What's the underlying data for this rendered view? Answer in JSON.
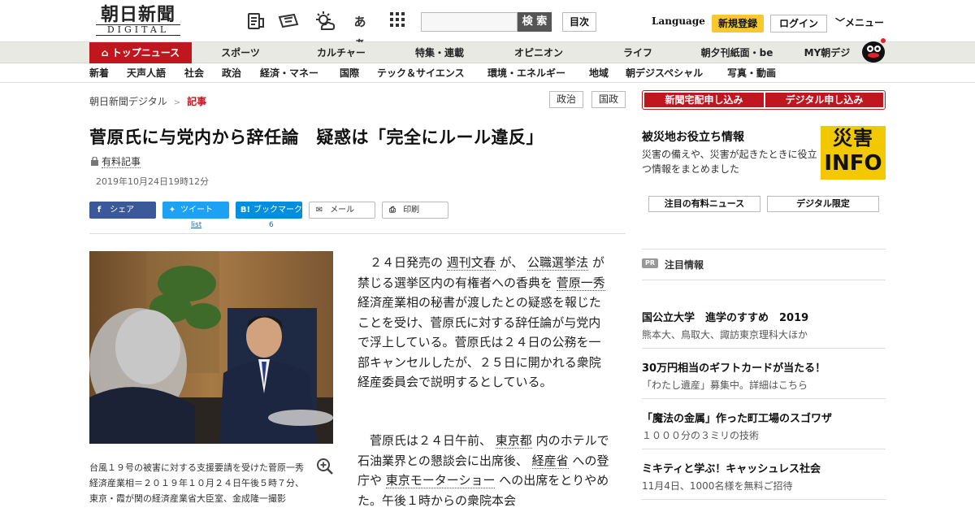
{
  "header": {
    "logo_main": "朝日新聞",
    "logo_sub": "DIGITAL",
    "icons": [
      "newspaper-icon",
      "ticket-icon",
      "weather-icon",
      "font-size-icon",
      "grid-icon"
    ],
    "font_toggle": "あぁ",
    "search_button": "検 索",
    "index_button": "目次",
    "language": "Language",
    "register": "新規登録",
    "login": "ログイン",
    "menu": "メニュー"
  },
  "nav_primary": [
    {
      "label": "トップニュース",
      "active": true
    },
    {
      "label": "スポーツ"
    },
    {
      "label": "カルチャー"
    },
    {
      "label": "特集・連載"
    },
    {
      "label": "オピニオン"
    },
    {
      "label": "ライフ"
    },
    {
      "label": "朝夕刊紙面・be"
    },
    {
      "label": "MY朝デジ"
    }
  ],
  "nav_secondary": [
    "新着",
    "天声人語",
    "社会",
    "政治",
    "経済・マネー",
    "国際",
    "テック＆サイエンス",
    "環境・エネルギー",
    "地域",
    "朝デジスペシャル",
    "写真・動画"
  ],
  "breadcrumb": {
    "home": "朝日新聞デジタル",
    "sep": ">",
    "current": "記事"
  },
  "tags": [
    "政治",
    "国政"
  ],
  "article": {
    "title": "菅原氏に与党内から辞任論　疑惑は「完全にルール違反」",
    "paid_label": "有料記事",
    "date": "2019年10月24日19時12分",
    "share": {
      "facebook": "シェア",
      "twitter": "ツイート",
      "twitter_count": "list",
      "hatena": "ブックマーク",
      "hatena_count": "6",
      "mail": "メール",
      "print": "印刷"
    },
    "caption": "台風１９号の被害に対する支援要請を受けた菅原一秀経済産業相＝２０１９年１０月２４日午後５時７分、東京・霞が関の経済産業省大臣室、金成隆一撮影",
    "para1": [
      {
        "t": "２４日発売の "
      },
      {
        "t": "週刊文春",
        "link": true
      },
      {
        "t": " が、 "
      },
      {
        "t": "公職選挙法",
        "link": true
      },
      {
        "t": " が禁じる選挙区内の有権者への香典を "
      },
      {
        "t": "菅原一秀",
        "link": true
      },
      {
        "t": " 経済産業相の秘書が渡したとの疑惑を報じたことを受け、菅原氏に対する辞任論が与党内で浮上している。菅原氏は２４日の公務を一部キャンセルしたが、２５日に開かれる衆院経産委員会で説明するとしている。"
      }
    ],
    "para2": [
      {
        "t": "菅原氏は２４日午前、 "
      },
      {
        "t": "東京都",
        "link": true
      },
      {
        "t": " 内のホテルで石油業界との懇談会に出席後、 "
      },
      {
        "t": "経産省",
        "link": true
      },
      {
        "t": " への登庁や "
      },
      {
        "t": "東京モーターショー",
        "link": true
      },
      {
        "t": " への出席をとりやめた。午後１時からの衆院本会"
      }
    ]
  },
  "sidebar": {
    "subscribe_paper": "新聞宅配申し込み",
    "subscribe_digital": "デジタル申し込み",
    "disaster_title": "被災地お役立ち情報",
    "disaster_desc": "災害の備えや、災害が起きたときに役立つ情報をまとめました",
    "disaster_logo_1": "災害",
    "disaster_logo_2": "INFO",
    "tab_paid": "注目の有料ニュース",
    "tab_digital": "デジタル限定",
    "pr_badge": "PR",
    "pr_title": "注目情報",
    "pr_items": [
      {
        "headline": "国公立大学　進学のすすめ　2019",
        "sub": "熊本大、鳥取大、諏訪東京理科大ほか"
      },
      {
        "headline": "30万円相当のギフトカードが当たる！",
        "sub": "「わたし遺産」募集中。詳細はこちら"
      },
      {
        "headline": "「魔法の金属」作った町工場のスゴワザ",
        "sub": "１０００分の３ミリの技術"
      },
      {
        "headline": "ミキティと学ぶ！キャッシュレス社会",
        "sub": "11月4日、1000名様を無料ご招待"
      }
    ]
  },
  "colors": {
    "brand_red": "#c0161e",
    "register_yellow": "#f7c830",
    "disaster_yellow": "#f2c800"
  }
}
